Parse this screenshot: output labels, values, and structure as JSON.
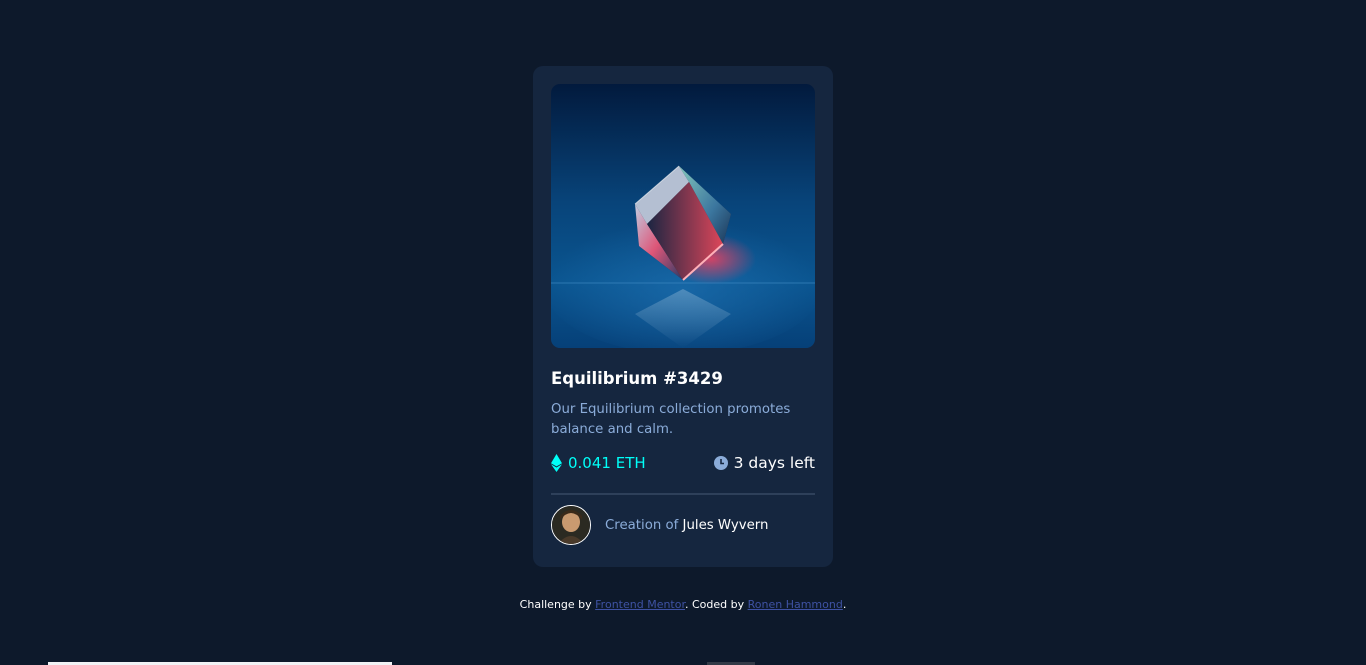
{
  "card": {
    "image_alt": "equilibrium-image",
    "title": "Equilibrium #3429",
    "description": "Our Equilibrium collection promotes balance and calm.",
    "price": "0.041 ETH",
    "price_icon": "ethereum-icon",
    "time_left": "3 days left",
    "time_icon": "clock-icon",
    "creator_prefix": "Creation of",
    "creator_name": "Jules Wyvern"
  },
  "attribution": {
    "challenge_prefix": "Challenge by",
    "challenge_link": "Frontend Mentor",
    "coded_prefix": ". Coded by",
    "coder_link": "Ronen Hammond",
    "suffix": "."
  },
  "colors": {
    "page_background": "#0d192b",
    "card_background": "#15263f",
    "accent_cyan": "#00fff8",
    "soft_blue": "#8bacd9",
    "link_blue": "#3e52a3",
    "white": "#ffffff"
  }
}
